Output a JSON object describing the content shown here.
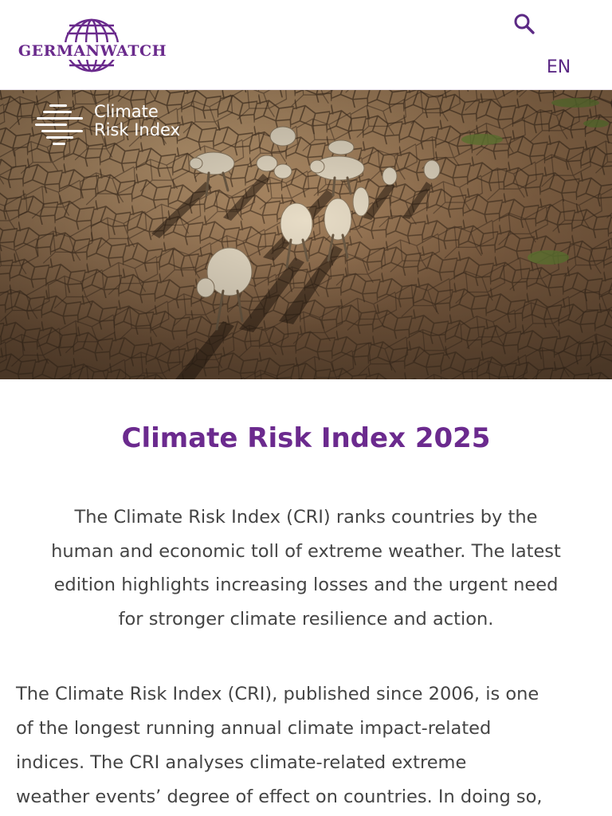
{
  "header": {
    "logo_text": "GERMANWATCH",
    "search_icon": "search-icon",
    "language": "EN"
  },
  "hero": {
    "logo_line1": "Climate",
    "logo_line2": "Risk Index"
  },
  "main": {
    "title": "Climate Risk Index 2025",
    "intro_lines": [
      "The Climate Risk Index (CRI) ranks countries by the",
      "human and economic toll of extreme weather. The latest",
      "edition highlights increasing losses and the urgent need",
      "for stronger climate resilience and action."
    ],
    "body_lines": [
      "The Climate Risk Index (CRI), published since 2006, is one",
      "of the longest running annual climate impact-related",
      "indices. The CRI analyses climate-related extreme",
      "weather events’ degree of effect on countries. In doing so,"
    ]
  },
  "colors": {
    "brand_purple": "#6b2a8e",
    "body_text": "#444444",
    "hero_earth": "#8a6748"
  }
}
